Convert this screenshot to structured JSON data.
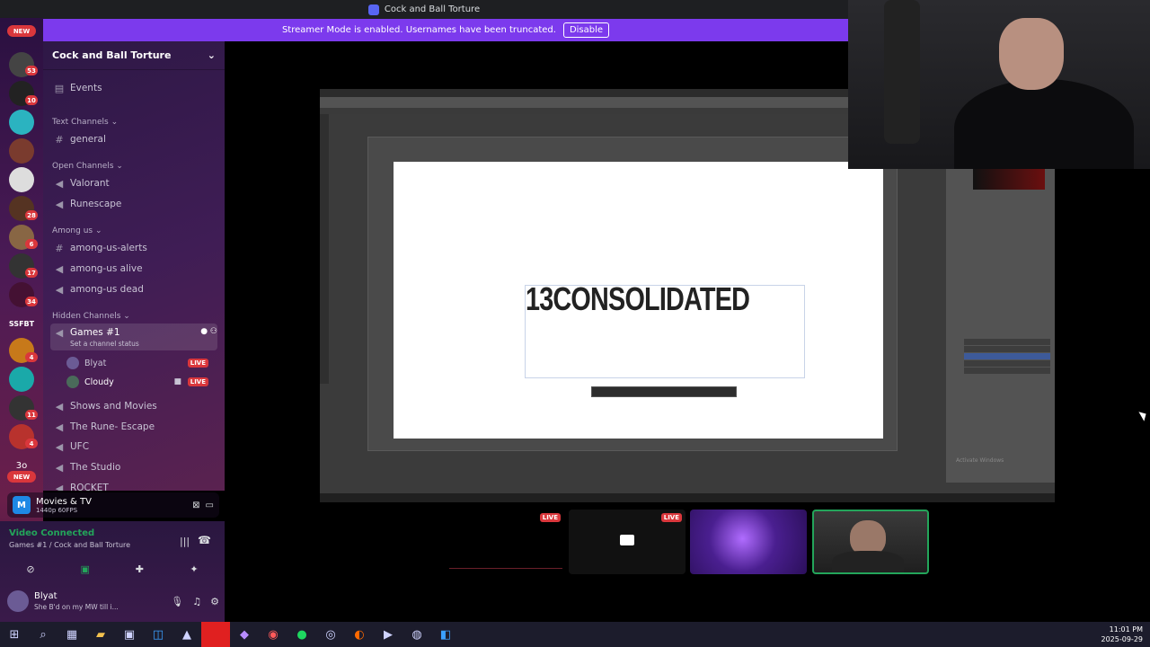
{
  "window": {
    "title": "Cock and Ball Torture"
  },
  "streamer_banner": {
    "text": "Streamer Mode is enabled. Usernames have been truncated.",
    "button": "Disable"
  },
  "rail": {
    "new_top": "NEW",
    "new_bottom": "NEW",
    "badges": [
      "53",
      "10",
      "28",
      "6",
      "17",
      "34",
      "4",
      "11",
      "4"
    ],
    "text_server_1": "SSFBT",
    "text_server_2": "3o"
  },
  "server": {
    "name": "Cock and Ball Torture"
  },
  "channels": {
    "events": "Events",
    "cat_text": "Text Channels",
    "general": "general",
    "cat_open": "Open Channels",
    "valorant": "Valorant",
    "runescape": "Runescape",
    "cat_among": "Among us",
    "among_alerts": "among-us-alerts",
    "among_alive": "among-us alive",
    "among_dead": "among-us dead",
    "cat_hidden": "Hidden Channels",
    "games": "Games #1",
    "games_status": "Set a channel status",
    "user1": "Blyat",
    "user2": "Cloudy",
    "live": "LIVE",
    "shows": "Shows and Movies",
    "rune_escape": "The Rune- Escape",
    "ufc": "UFC",
    "studio": "The Studio",
    "rocket": "ROCKET"
  },
  "activity": {
    "app": "Movies & TV",
    "detail": "1440p 60FPS"
  },
  "voice": {
    "status": "Video Connected",
    "location": "Games #1 / Cock and Ball Torture"
  },
  "me": {
    "name": "Blyat",
    "status": "She B'd on my MW till i..."
  },
  "stream": {
    "canvas_text": "13CONSOLIDATED",
    "activate": "Activate Windows"
  },
  "thumbs": {
    "live": "LIVE"
  },
  "clock": {
    "time": "11:01 PM",
    "date": "2025-09-29"
  },
  "colors": {
    "accent": "#7c3aed",
    "live": "#da373c",
    "connected": "#23a55a"
  }
}
